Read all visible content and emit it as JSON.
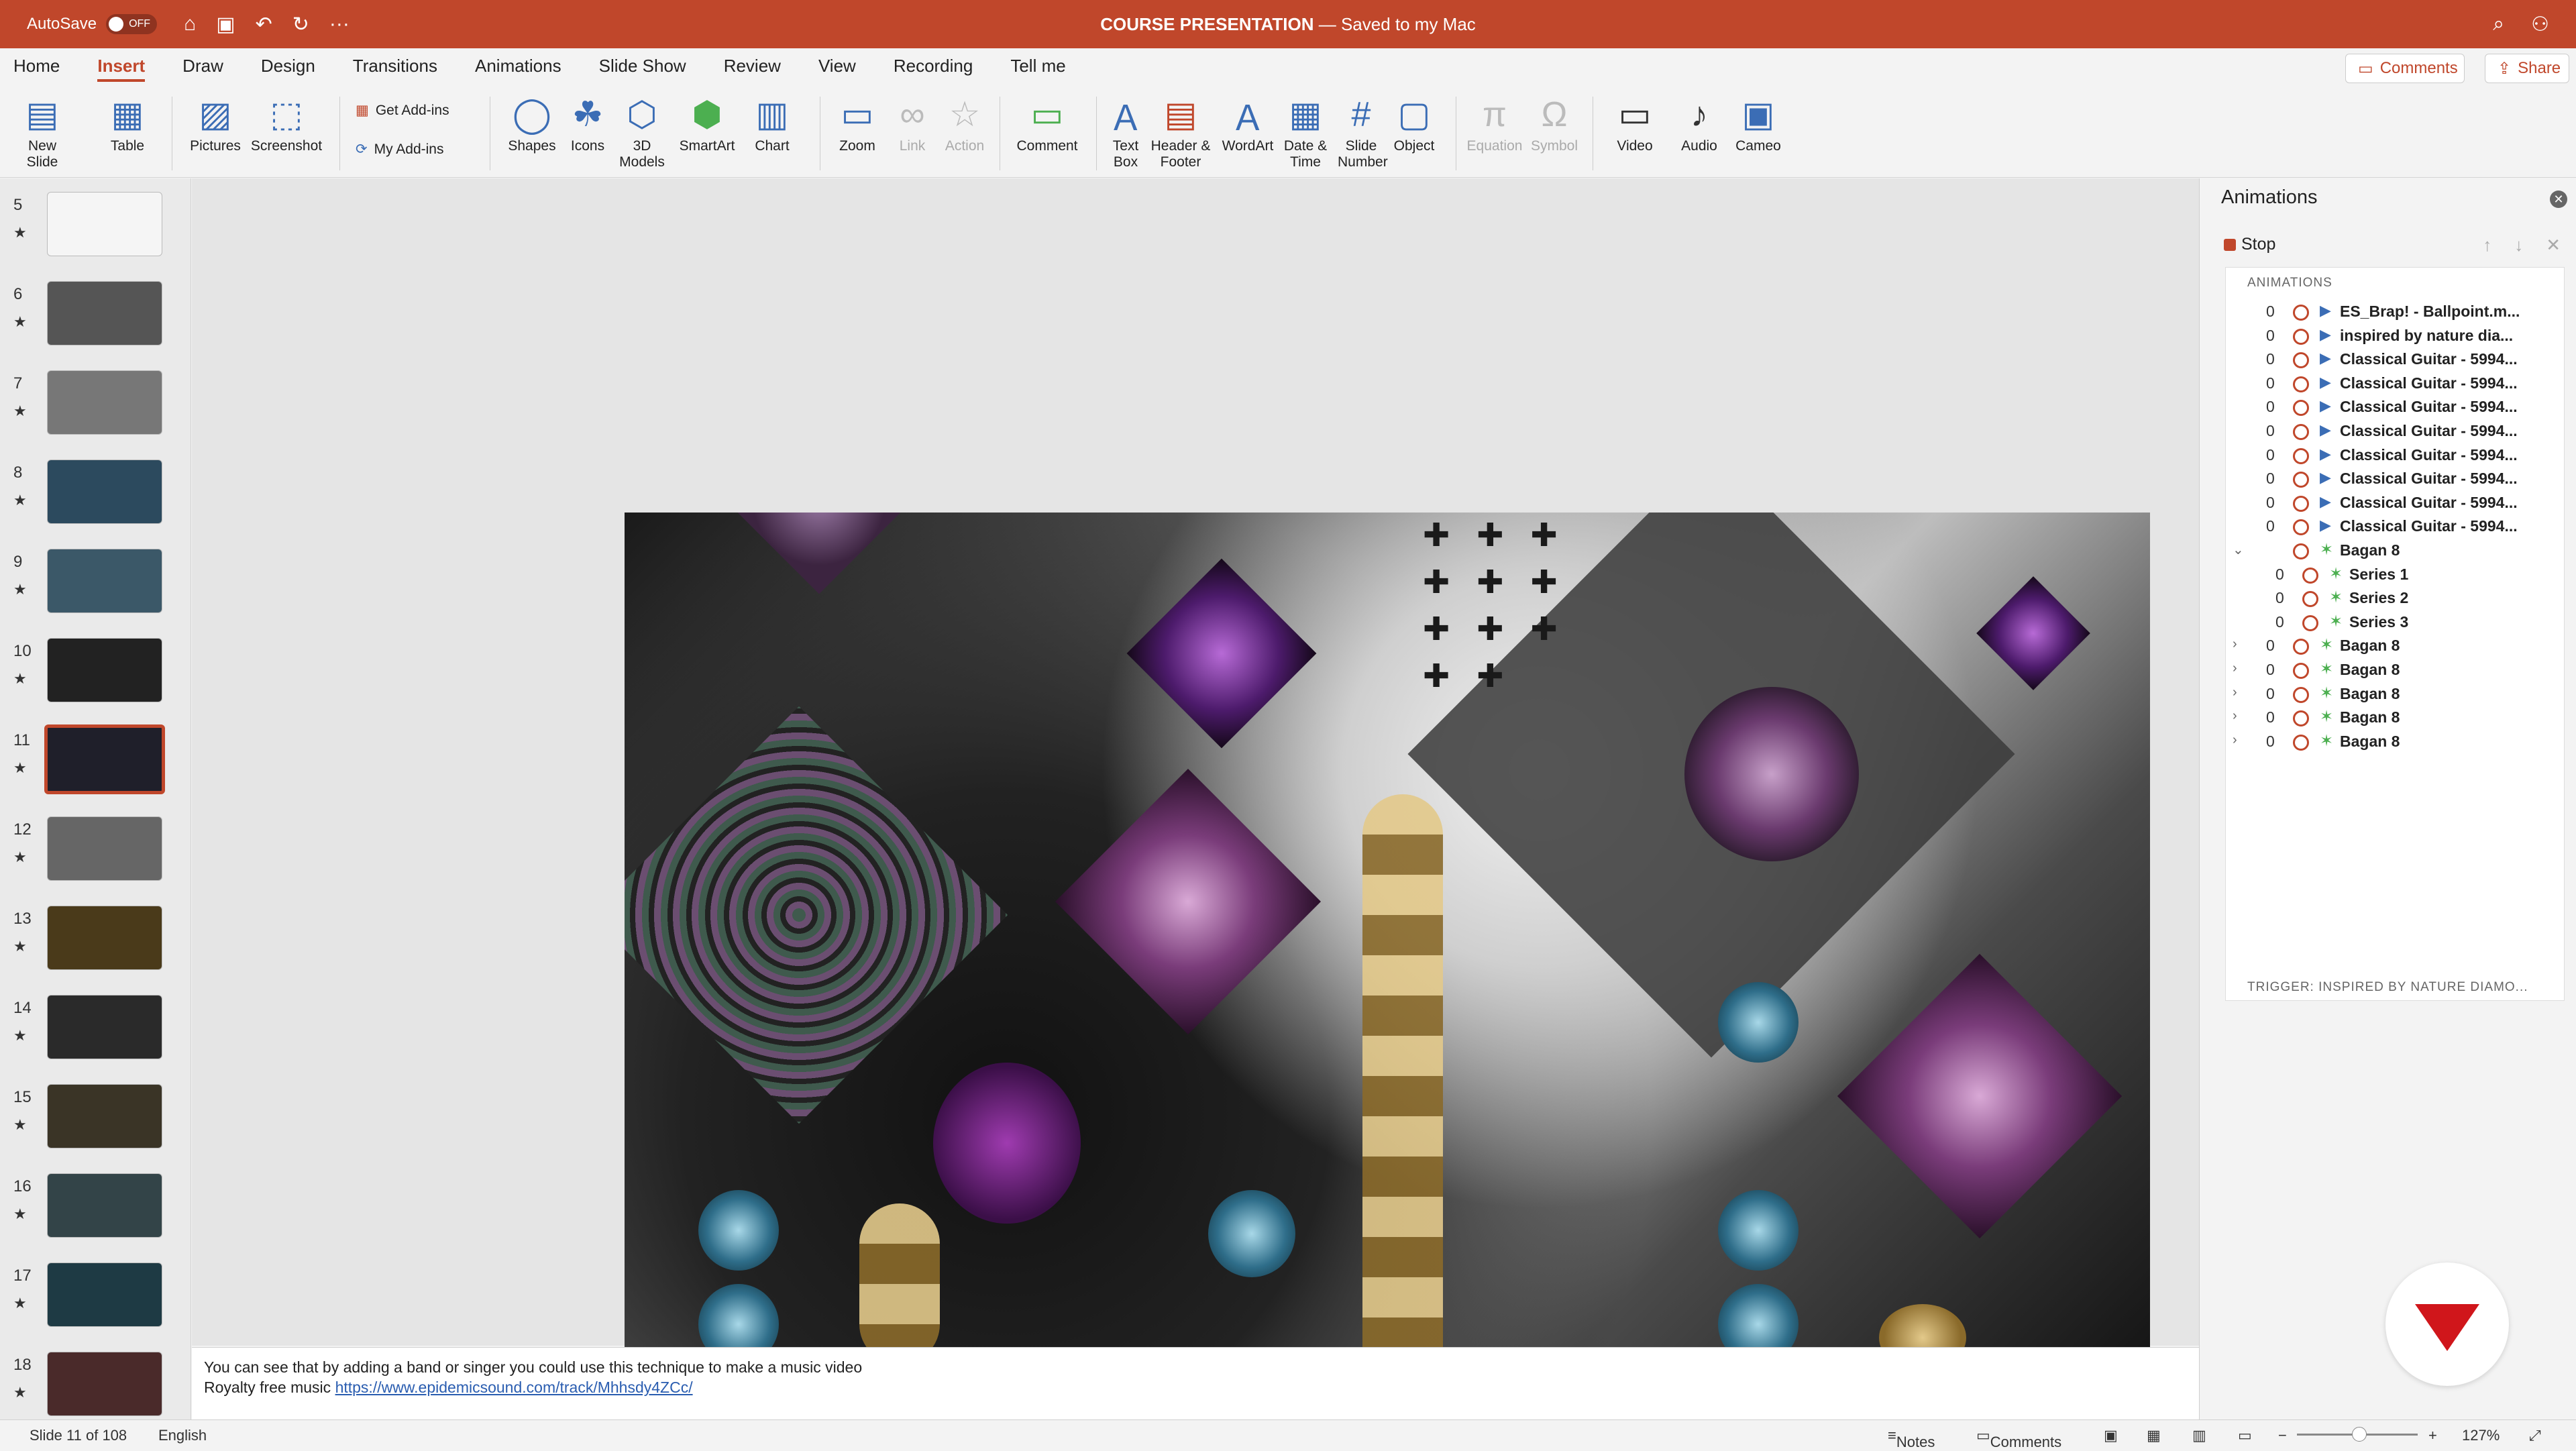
{
  "titlebar": {
    "autosave_label": "AutoSave",
    "autosave_state": "OFF",
    "doc_title": "COURSE PRESENTATION",
    "doc_status": "— Saved to my Mac"
  },
  "tabs": [
    "Home",
    "Insert",
    "Draw",
    "Design",
    "Transitions",
    "Animations",
    "Slide Show",
    "Review",
    "View",
    "Recording",
    "Tell me"
  ],
  "top_buttons": {
    "comments": "Comments",
    "share": "Share"
  },
  "ribbon": {
    "new_slide": "New Slide",
    "table": "Table",
    "pictures": "Pictures",
    "screenshot": "Screenshot",
    "get_addins": "Get Add-ins",
    "my_addins": "My Add-ins",
    "shapes": "Shapes",
    "icons": "Icons",
    "models": "3D Models",
    "smartart": "SmartArt",
    "chart": "Chart",
    "zoom": "Zoom",
    "link": "Link",
    "action": "Action",
    "comment": "Comment",
    "textbox": "Text Box",
    "header_footer": "Header & Footer",
    "wordart": "WordArt",
    "date_time": "Date & Time",
    "slide_number": "Slide Number",
    "object": "Object",
    "equation": "Equation",
    "symbol": "Symbol",
    "video": "Video",
    "audio": "Audio",
    "cameo": "Cameo"
  },
  "slides": [
    {
      "num": "5"
    },
    {
      "num": "6"
    },
    {
      "num": "7"
    },
    {
      "num": "8"
    },
    {
      "num": "9"
    },
    {
      "num": "10"
    },
    {
      "num": "11"
    },
    {
      "num": "12"
    },
    {
      "num": "13"
    },
    {
      "num": "14"
    },
    {
      "num": "15"
    },
    {
      "num": "16"
    },
    {
      "num": "17"
    },
    {
      "num": "18"
    }
  ],
  "selected_slide": "11",
  "notes": {
    "line1": "You can see that by adding a band or singer you could use this technique to make a music video",
    "line2_prefix": "Royalty free music ",
    "line2_link": "https://www.epidemicsound.com/track/Mhhsdy4ZCc/"
  },
  "animations_pane": {
    "title": "Animations",
    "stop_label": "Stop",
    "section_label": "ANIMATIONS",
    "trigger_label": "TRIGGER: INSPIRED BY NATURE DIAMO...",
    "items": [
      {
        "num": "0",
        "label": "ES_Brap! - Ballpoint.m...",
        "kind": "play"
      },
      {
        "num": "0",
        "label": "inspired by nature dia...",
        "kind": "play"
      },
      {
        "num": "0",
        "label": "Classical Guitar - 5994...",
        "kind": "play"
      },
      {
        "num": "0",
        "label": "Classical Guitar - 5994...",
        "kind": "play"
      },
      {
        "num": "0",
        "label": "Classical Guitar - 5994...",
        "kind": "play"
      },
      {
        "num": "0",
        "label": "Classical Guitar - 5994...",
        "kind": "play"
      },
      {
        "num": "0",
        "label": "Classical Guitar - 5994...",
        "kind": "play"
      },
      {
        "num": "0",
        "label": "Classical Guitar - 5994...",
        "kind": "play"
      },
      {
        "num": "0",
        "label": "Classical Guitar - 5994...",
        "kind": "play"
      },
      {
        "num": "0",
        "label": "Classical Guitar - 5994...",
        "kind": "play"
      },
      {
        "num": "",
        "label": "Bagan 8",
        "kind": "effect",
        "expand": "⌄"
      },
      {
        "num": "0",
        "label": "Series 1",
        "kind": "effect",
        "sub": true
      },
      {
        "num": "0",
        "label": "Series 2",
        "kind": "effect",
        "sub": true
      },
      {
        "num": "0",
        "label": "Series 3",
        "kind": "effect",
        "sub": true
      },
      {
        "num": "0",
        "label": "Bagan 8",
        "kind": "effect",
        "expand": "›"
      },
      {
        "num": "0",
        "label": "Bagan 8",
        "kind": "effect",
        "expand": "›"
      },
      {
        "num": "0",
        "label": "Bagan 8",
        "kind": "effect",
        "expand": "›"
      },
      {
        "num": "0",
        "label": "Bagan 8",
        "kind": "effect",
        "expand": "›"
      },
      {
        "num": "0",
        "label": "Bagan 8",
        "kind": "effect",
        "expand": "›"
      }
    ]
  },
  "status": {
    "slide_info": "Slide 11 of 108",
    "language": "English",
    "notes": "Notes",
    "comments": "Comments",
    "zoom": "127%"
  },
  "colors": {
    "accent": "#c0472b",
    "icon_blue": "#3b6db5"
  }
}
